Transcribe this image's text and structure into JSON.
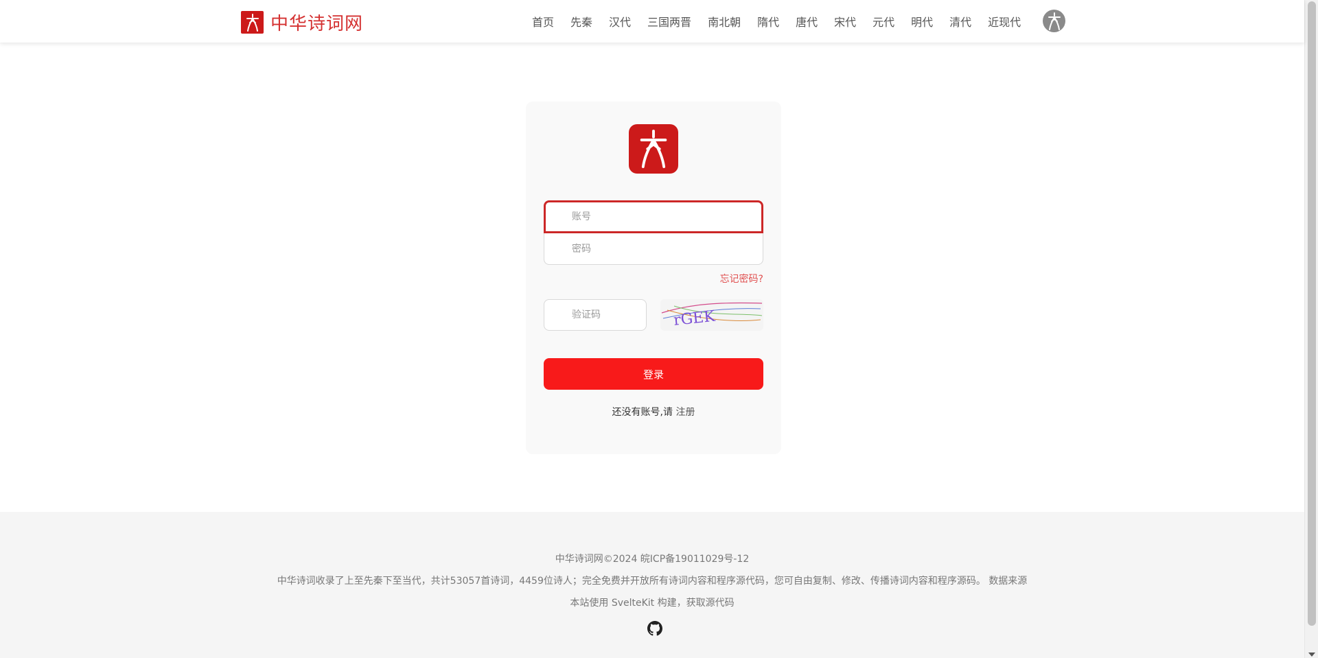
{
  "header": {
    "site_name": "中华诗词网",
    "nav": [
      "首页",
      "先秦",
      "汉代",
      "三国两晋",
      "南北朝",
      "隋代",
      "唐代",
      "宋代",
      "元代",
      "明代",
      "清代",
      "近现代"
    ]
  },
  "login": {
    "account_placeholder": "账号",
    "password_placeholder": "密码",
    "forgot_label": "忘记密码?",
    "captcha_placeholder": "验证码",
    "captcha_text": "rGEK",
    "login_button": "登录",
    "register_prompt": "还没有账号,请",
    "register_link": "注册"
  },
  "footer": {
    "copyright": "中华诗词网©2024 皖ICP备19011029号-12",
    "description": "中华诗词收录了上至先秦下至当代，共计53057首诗词，4459位诗人；完全免费并开放所有诗词内容和程序源代码，您可自由复制、修改、传播诗词内容和程序源码。",
    "data_source": "数据来源",
    "built_with": "本站使用 SvelteKit 构建，获取源代码"
  },
  "colors": {
    "brand_red": "#cc1a1a",
    "button_red": "#f81a1a",
    "link_red": "#e05050"
  },
  "icons": {
    "logo": "poetry-logo-icon",
    "avatar": "user-avatar-icon",
    "github": "github-icon"
  }
}
